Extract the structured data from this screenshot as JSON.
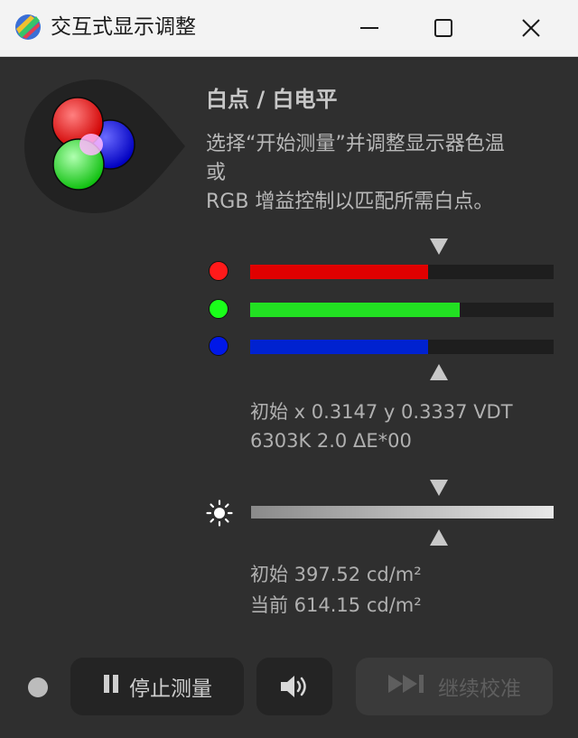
{
  "window": {
    "title": "交互式显示调整"
  },
  "section": {
    "title": "白点 / 白电平",
    "description_lines": [
      "选择“开始测量”并调整显示器色温",
      "或",
      "RGB 增益控制以匹配所需白点。"
    ]
  },
  "gain_bars": [
    {
      "channel": "red",
      "color": "#e00000",
      "dot_color": "#ff1a1a",
      "level": 0.585
    },
    {
      "channel": "green",
      "color": "#22e022",
      "dot_color": "#1aff1a",
      "level": 0.69
    },
    {
      "channel": "blue",
      "color": "#0022d0",
      "dot_color": "#0018e8",
      "level": 0.585
    }
  ],
  "white_point": {
    "line1": "初始 x 0.3147 y 0.3337 VDT",
    "line2": "6303K 2.0 ΔE*00"
  },
  "luminance": {
    "line1": "初始 397.52 cd/m²",
    "line2": "当前 614.15 cd/m²"
  },
  "buttons": {
    "stop_label": "停止测量",
    "continue_label": "继续校准"
  },
  "icons": [
    "app-logo-icon",
    "minimize-icon",
    "maximize-icon",
    "close-icon",
    "rgb-circles-icon",
    "brightness-icon",
    "pause-icon",
    "speaker-icon",
    "skip-forward-icon"
  ]
}
